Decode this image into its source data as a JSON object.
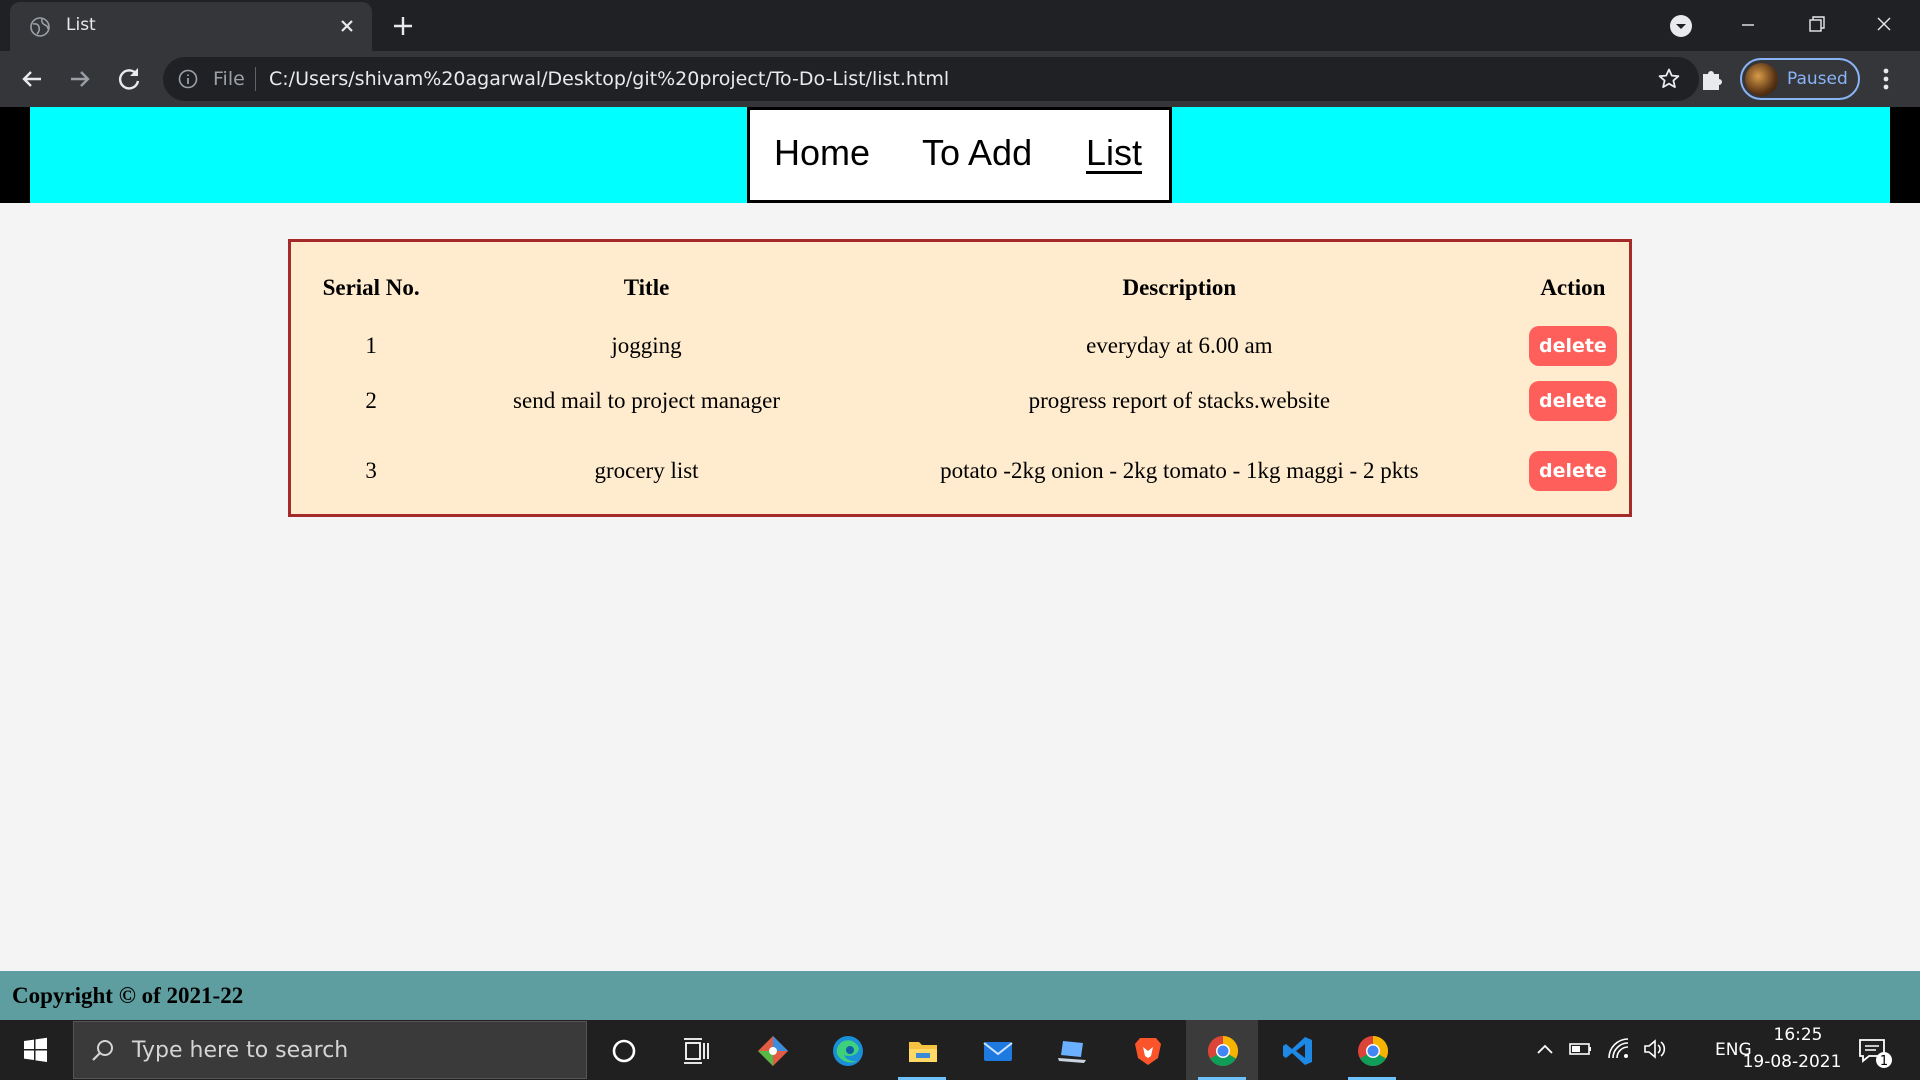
{
  "browser": {
    "tab_title": "List",
    "omnibox_scheme": "File",
    "url": "C:/Users/shivam%20agarwal/Desktop/git%20project/To-Do-List/list.html",
    "profile_label": "Paused"
  },
  "nav": {
    "home": "Home",
    "add": "To Add",
    "list": "List"
  },
  "table": {
    "headers": [
      "Serial No.",
      "Title",
      "Description",
      "Action"
    ],
    "rows": [
      {
        "serial": "1",
        "title": "jogging",
        "description": "everyday at 6.00 am",
        "action": "delete"
      },
      {
        "serial": "2",
        "title": "send mail to project manager",
        "description": "progress report of stacks.website",
        "action": "delete"
      },
      {
        "serial": "3",
        "title": "grocery list",
        "description": "potato -2kg onion - 2kg tomato - 1kg maggi - 2 pkts",
        "action": "delete"
      }
    ]
  },
  "footer": {
    "text": "Copyright © of 2021-22"
  },
  "taskbar": {
    "search_placeholder": "Type here to search",
    "language": "ENG",
    "time": "16:25",
    "date": "19-08-2021",
    "notification_count": "1"
  },
  "colors": {
    "header_cyan": "#00ffff",
    "table_bg": "#ffebcd",
    "table_border": "#a52a2a",
    "delete_button": "#ff5f5a",
    "footer_bg": "#5f9ea0"
  }
}
